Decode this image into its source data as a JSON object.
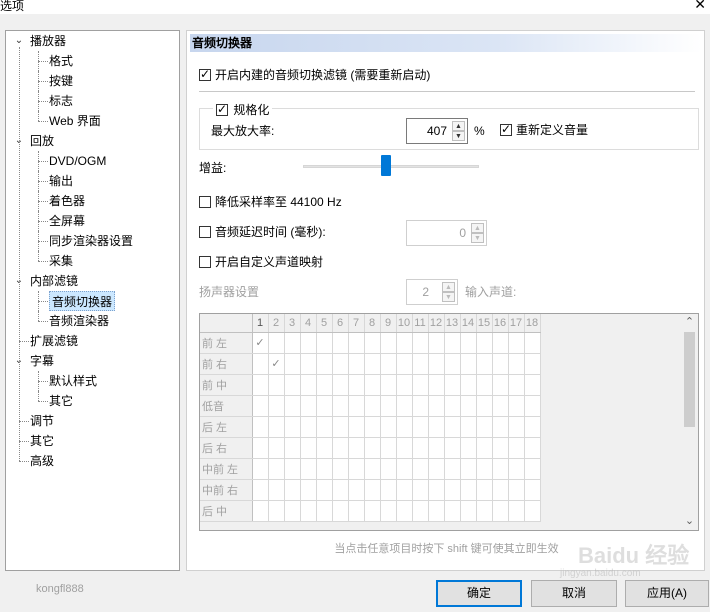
{
  "window": {
    "title": "选项",
    "close_glyph": "✕"
  },
  "tree": [
    {
      "label": "播放器",
      "level": 0,
      "toggle": "v"
    },
    {
      "label": "格式",
      "level": 1
    },
    {
      "label": "按键",
      "level": 1
    },
    {
      "label": "标志",
      "level": 1
    },
    {
      "label": "Web 界面",
      "level": 1
    },
    {
      "label": "回放",
      "level": 0,
      "toggle": "v"
    },
    {
      "label": "DVD/OGM",
      "level": 1
    },
    {
      "label": "输出",
      "level": 1
    },
    {
      "label": "着色器",
      "level": 1
    },
    {
      "label": "全屏幕",
      "level": 1
    },
    {
      "label": "同步渲染器设置",
      "level": 1
    },
    {
      "label": "采集",
      "level": 1
    },
    {
      "label": "内部滤镜",
      "level": 0,
      "toggle": "v"
    },
    {
      "label": "音频切换器",
      "level": 1,
      "selected": true
    },
    {
      "label": "音频渲染器",
      "level": 1
    },
    {
      "label": "扩展滤镜",
      "level": 0
    },
    {
      "label": "字幕",
      "level": 0,
      "toggle": "v"
    },
    {
      "label": "默认样式",
      "level": 1
    },
    {
      "label": "其它",
      "level": 1
    },
    {
      "label": "调节",
      "level": 0
    },
    {
      "label": "其它",
      "level": 0
    },
    {
      "label": "高级",
      "level": 0
    }
  ],
  "panel": {
    "header": "音频切换器",
    "enable_switcher": {
      "label": "开启内建的音频切换滤镜 (需要重新启动)",
      "checked": true
    },
    "normalize": {
      "label": "规格化",
      "checked": true,
      "max_amp_label": "最大放大率:",
      "max_amp_value": "407",
      "unit": "%",
      "redefine_volume": {
        "label": "重新定义音量",
        "checked": true
      }
    },
    "gain": {
      "label": "增益:",
      "level": 0.47
    },
    "downsample": {
      "label": "降低采样率至 44100 Hz",
      "checked": false
    },
    "delay": {
      "label": "音频延迟时间 (毫秒):",
      "checked": false,
      "value": "0"
    },
    "custom_map": {
      "label": "开启自定义声道映射",
      "checked": false
    },
    "speaker": {
      "label": "扬声器设置",
      "value": "2",
      "input_label": "输入声道:"
    },
    "matrix": {
      "columns": [
        "1",
        "2",
        "3",
        "4",
        "5",
        "6",
        "7",
        "8",
        "9",
        "10",
        "11",
        "12",
        "13",
        "14",
        "15",
        "16",
        "17",
        "18"
      ],
      "rows": [
        "前 左",
        "前 右",
        "前 中",
        "低音",
        "后 左",
        "后 右",
        "中前 左",
        "中前 右",
        "后 中"
      ],
      "checks": [
        [
          0,
          0
        ],
        [
          1,
          1
        ]
      ],
      "check_glyph": "✓"
    },
    "hint": "当点击任意项目时按下 shift 键可使其立即生效"
  },
  "footer": {
    "user": "kongfl888",
    "ok": "确定",
    "cancel": "取消",
    "apply": "应用(A)"
  },
  "watermark": {
    "brand": "Baidu 经验",
    "url": "jingyan.baidu.com"
  },
  "icons": {
    "scroll_up": "⌃",
    "scroll_down": "⌄",
    "spin_up": "▲",
    "spin_down": "▼"
  }
}
